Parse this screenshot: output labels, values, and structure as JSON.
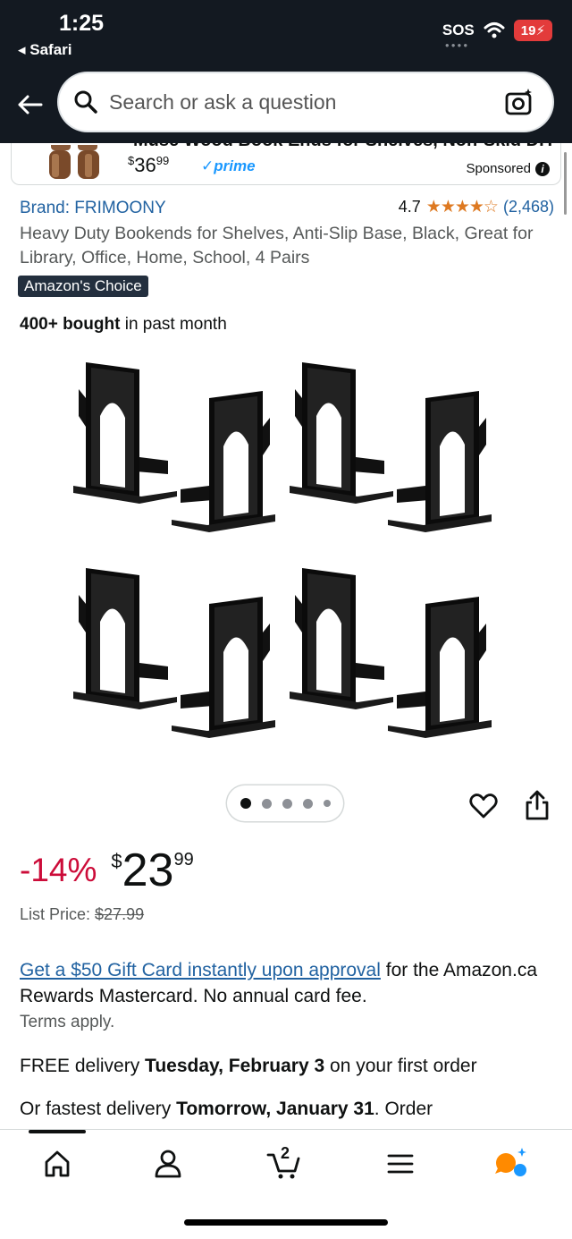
{
  "status_bar": {
    "time": "1:25",
    "back_app": "Safari",
    "sos": "SOS",
    "battery": "19"
  },
  "search": {
    "placeholder": "Search or ask a question"
  },
  "sponsored": {
    "title_cut": "Muse Wood Book Ends for Shelves, Non-Skid DIY",
    "price_dollars": "36",
    "price_cents": "99",
    "prime": "prime",
    "label": "Sponsored"
  },
  "product": {
    "brand": "Brand: FRIMOONY",
    "rating_value": "4.7",
    "rating_stars": 4.7,
    "rating_count": "(2,468)",
    "title": "Heavy Duty Bookends for Shelves, Anti-Slip Base, Black, Great for Library, Office, Home, School, 4 Pairs",
    "badge": "Amazon's Choice",
    "bought_bold": "400+ bought",
    "bought_rest": " in past month",
    "image_count": 5,
    "image_index": 1
  },
  "pricing": {
    "discount": "-14%",
    "currency": "$",
    "whole": "23",
    "fraction": "99",
    "list_label": "List Price: ",
    "list_value": "$27.99"
  },
  "offer": {
    "link": "Get a $50 Gift Card instantly upon approval",
    "rest": " for the Amazon.ca Rewards Mastercard. No annual card fee.",
    "terms": "Terms apply."
  },
  "delivery": {
    "free_prefix": "FREE delivery ",
    "free_date": "Tuesday, February 3",
    "free_suffix": " on your first order",
    "fast_prefix": "Or fastest delivery ",
    "fast_date": "Tomorrow, January 31",
    "fast_suffix": ". Order"
  },
  "bottom_nav": {
    "cart_count": "2"
  },
  "colors": {
    "header_bg": "#131921",
    "link": "#2162a1",
    "star": "#de7921",
    "discount": "#cc0c39",
    "prime": "#1a98ff",
    "badge_bg": "#232f3e"
  }
}
